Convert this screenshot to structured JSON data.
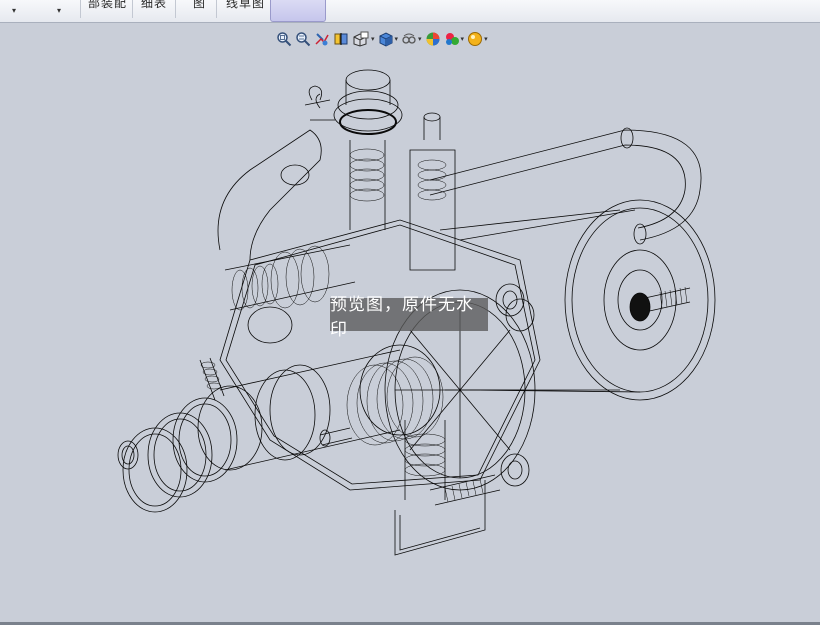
{
  "ribbon": {
    "dropdowns": [
      "▾",
      "▾"
    ],
    "tabs": [
      "部装配",
      "细表",
      "图",
      "线草图",
      ""
    ]
  },
  "heads_up_toolbar": {
    "tools": [
      {
        "icon": "zoom-to-fit-icon"
      },
      {
        "icon": "zoom-to-area-icon"
      },
      {
        "icon": "previous-view-icon"
      },
      {
        "icon": "section-view-icon"
      },
      {
        "icon": "view-orientation-icon",
        "dropdown": true
      },
      {
        "icon": "display-style-icon",
        "dropdown": true
      },
      {
        "icon": "hide-show-items-icon",
        "dropdown": true
      },
      {
        "icon": "edit-appearance-icon"
      },
      {
        "icon": "apply-scene-icon",
        "dropdown": true
      },
      {
        "icon": "view-settings-icon",
        "dropdown": true
      }
    ],
    "caret": "▾"
  },
  "watermark": "预览图，原件无水印",
  "colors": {
    "viewport_bg": "#c9ced8",
    "wire": "#0a0a0a"
  }
}
